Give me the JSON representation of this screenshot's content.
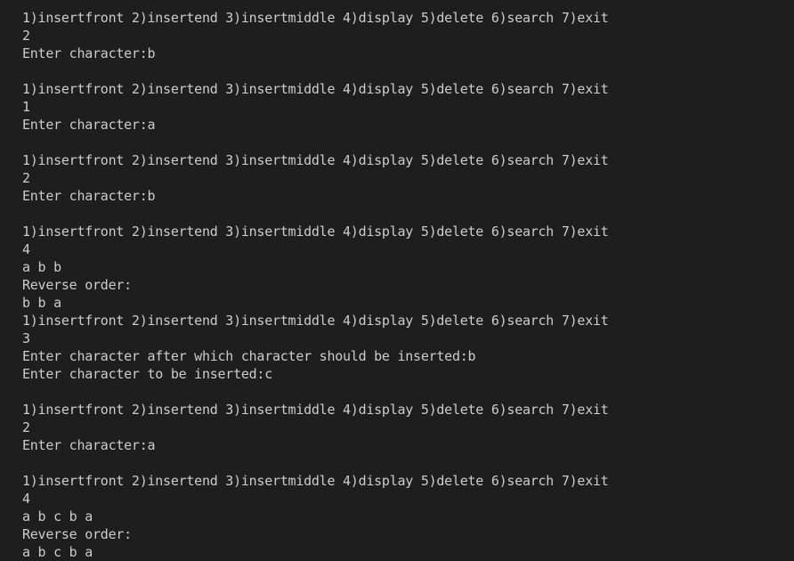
{
  "terminal": {
    "lines": [
      "1)insertfront 2)insertend 3)insertmiddle 4)display 5)delete 6)search 7)exit",
      "2",
      "Enter character:b",
      "",
      "1)insertfront 2)insertend 3)insertmiddle 4)display 5)delete 6)search 7)exit",
      "1",
      "Enter character:a",
      "",
      "1)insertfront 2)insertend 3)insertmiddle 4)display 5)delete 6)search 7)exit",
      "2",
      "Enter character:b",
      "",
      "1)insertfront 2)insertend 3)insertmiddle 4)display 5)delete 6)search 7)exit",
      "4",
      "a b b",
      "Reverse order:",
      "b b a",
      "1)insertfront 2)insertend 3)insertmiddle 4)display 5)delete 6)search 7)exit",
      "3",
      "Enter character after which character should be inserted:b",
      "Enter character to be inserted:c",
      "",
      "1)insertfront 2)insertend 3)insertmiddle 4)display 5)delete 6)search 7)exit",
      "2",
      "Enter character:a",
      "",
      "1)insertfront 2)insertend 3)insertmiddle 4)display 5)delete 6)search 7)exit",
      "4",
      "a b c b a",
      "Reverse order:",
      "a b c b a"
    ]
  }
}
